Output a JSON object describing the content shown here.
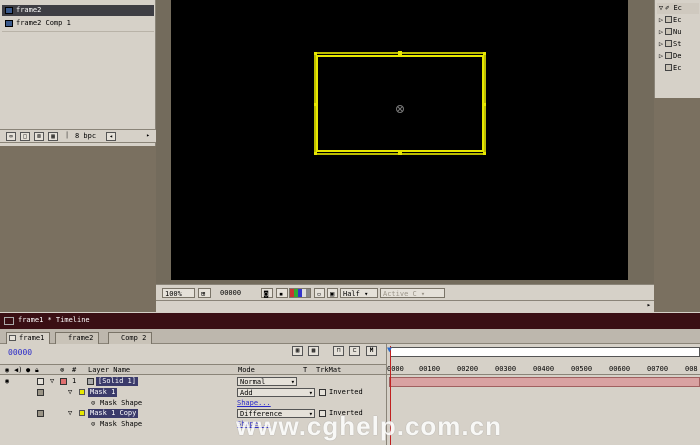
{
  "project": {
    "items": [
      {
        "label": "frame2",
        "selected": true
      },
      {
        "label": "frame2 Comp 1",
        "selected": false
      }
    ],
    "bpc_label": "8 bpc"
  },
  "viewer": {
    "zoom": "100%",
    "timecode": "00000",
    "resolution": "Half",
    "view": "Active C"
  },
  "effects": {
    "items": [
      "Ec",
      "Nu",
      "St",
      "De",
      "Ec"
    ]
  },
  "timeline": {
    "title": "frame1 * Timeline",
    "tabs": [
      "frame1",
      "frame2",
      "Comp 2"
    ],
    "current_time": "00000",
    "headers": {
      "layer_name": "Layer Name",
      "mode": "Mode",
      "t": "T",
      "trkmat": "TrkMat"
    },
    "ruler": [
      "0000",
      "00100",
      "00200",
      "00300",
      "00400",
      "00500",
      "00600",
      "00700",
      "008"
    ],
    "rows": {
      "layer_number": "1",
      "layer_name": "[Solid 1]",
      "layer_mode": "Normal",
      "mask1_name": "Mask 1",
      "mask1_mode": "Add",
      "mask1_inverted": "Inverted",
      "mask1_shape_label": "Mask Shape",
      "mask1_shape_value": "Shape...",
      "mask2_name": "Mask 1 Copy",
      "mask2_mode": "Difference",
      "mask2_inverted": "Inverted",
      "mask2_shape_label": "Mask Shape",
      "mask2_shape_value": "Shape..."
    }
  },
  "watermark": "www.cghelp.com.cn",
  "colors": {
    "mask": "#e8e800",
    "titlebar": "#3a0f14",
    "layer_bar": "#d9a2a2"
  }
}
